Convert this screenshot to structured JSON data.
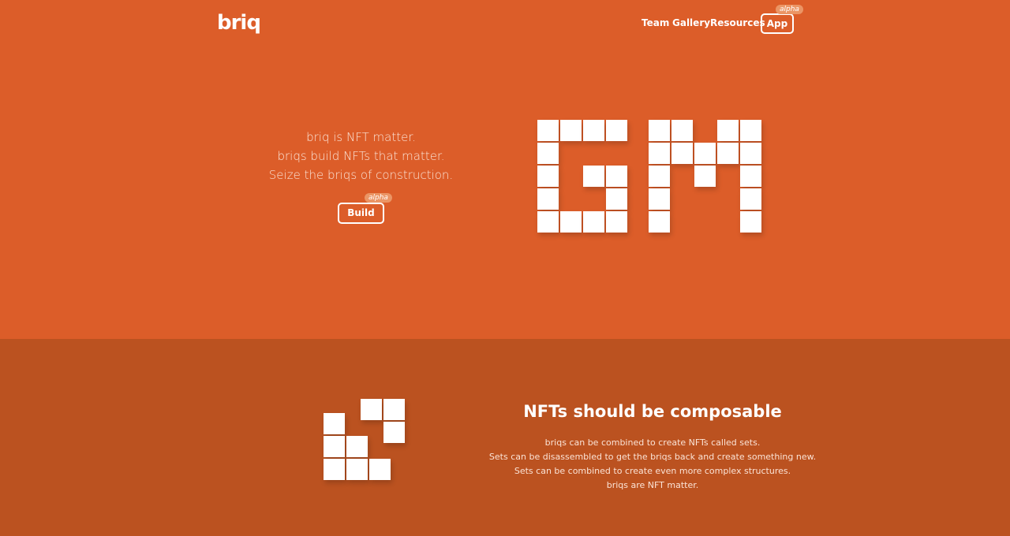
{
  "header": {
    "logo": "briq",
    "nav": [
      "Team",
      "Gallery",
      "Resources"
    ],
    "app_label": "App",
    "app_badge": "alpha"
  },
  "hero": {
    "lines": [
      "briq is NFT matter.",
      "briqs build NFTs that matter.",
      "Seize the briqs of construction."
    ],
    "build_label": "Build",
    "build_badge": "alpha",
    "graphic_text": "GM"
  },
  "composable": {
    "title": "NFTs should be composable",
    "lines": [
      "briqs can be combined to create NFTs called sets.",
      "Sets can be disassembled to get the briqs back and create something new.",
      "Sets can be combined to create even more complex structures.",
      "briqs are NFT matter."
    ]
  },
  "colors": {
    "hero_bg": "#dc5d29",
    "section_bg": "#bb5220",
    "badge": "#eb9565"
  }
}
